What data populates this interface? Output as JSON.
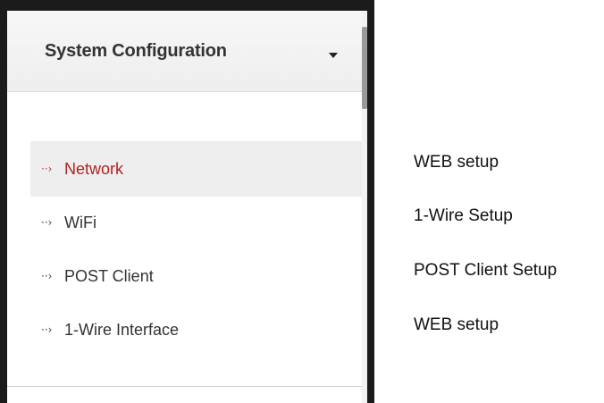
{
  "panel": {
    "title": "System Configuration",
    "dropdown_icon": "caret-down-icon",
    "items": [
      {
        "label": "Network",
        "icon": "dotted-arrow-icon",
        "active": true
      },
      {
        "label": "WiFi",
        "icon": "dotted-arrow-icon",
        "active": false
      },
      {
        "label": "POST Client",
        "icon": "dotted-arrow-icon",
        "active": false
      },
      {
        "label": "1-Wire Interface",
        "icon": "dotted-arrow-icon",
        "active": false
      }
    ]
  },
  "annotations": [
    "WEB setup",
    "1-Wire Setup",
    "POST Client Setup",
    "WEB setup"
  ],
  "colors": {
    "active_text": "#b22222",
    "active_background": "#eeeeee",
    "frame": "#1b1b1b"
  }
}
